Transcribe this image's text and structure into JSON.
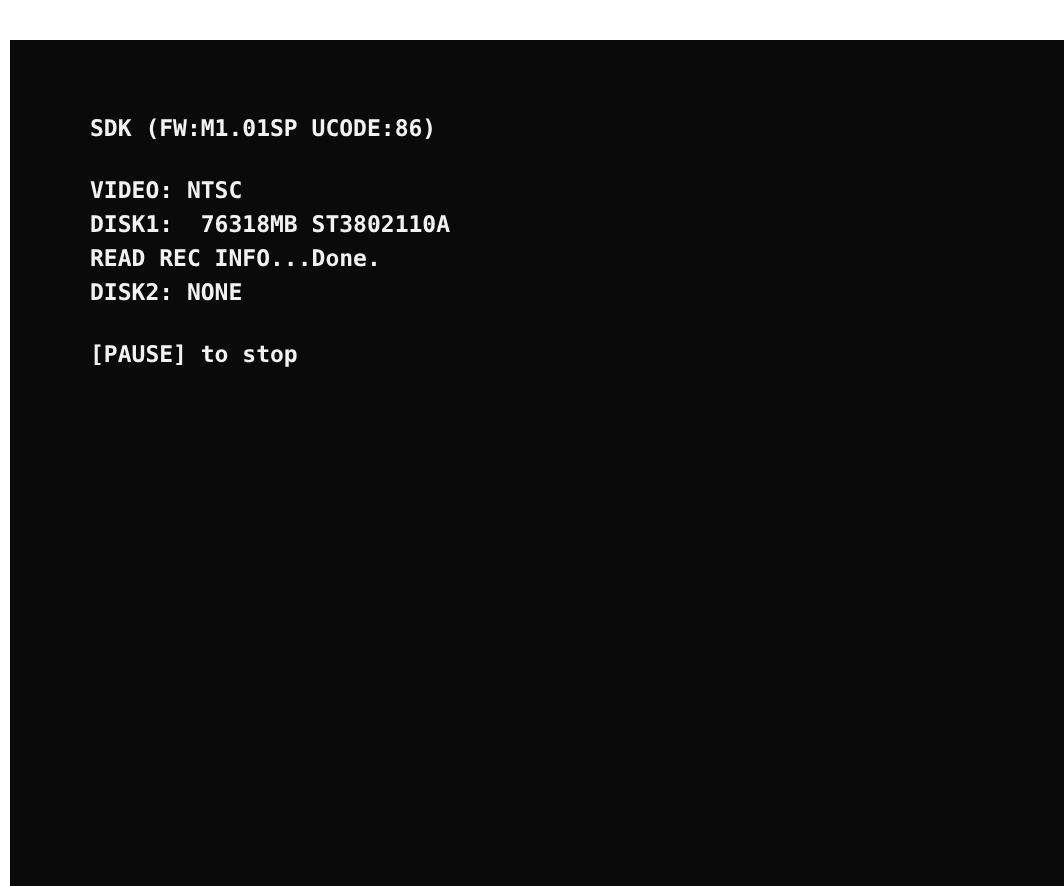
{
  "console": {
    "groups": [
      [
        "SDK (FW:M1.01SP UCODE:86)"
      ],
      [
        "VIDEO: NTSC",
        "DISK1:  76318MB ST3802110A",
        "READ REC INFO...Done.",
        "DISK2: NONE"
      ],
      [
        "[PAUSE] to stop"
      ]
    ]
  }
}
